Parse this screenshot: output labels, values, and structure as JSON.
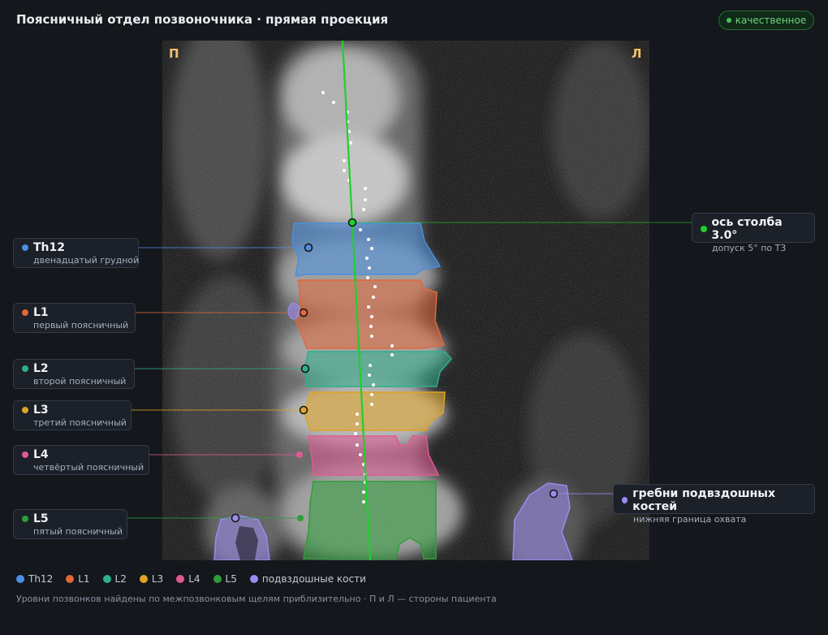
{
  "header": {
    "title": "Поясничный отдел позвоночника · прямая проекция",
    "quality_badge": "качественное"
  },
  "image": {
    "side_right_marker": "П",
    "side_left_marker": "Л"
  },
  "colors": {
    "th12": "#4a90e2",
    "l1": "#e2683a",
    "l2": "#2fae8a",
    "l3": "#e0a424",
    "l4": "#e05a92",
    "l5": "#2f9e3a",
    "iliac": "#9a8cf0",
    "axis": "#1fd02c"
  },
  "vertebrae": [
    {
      "id": "th12",
      "name": "Th12",
      "description": "двенадцатый грудной"
    },
    {
      "id": "l1",
      "name": "L1",
      "description": "первый поясничный"
    },
    {
      "id": "l2",
      "name": "L2",
      "description": "второй поясничный"
    },
    {
      "id": "l3",
      "name": "L3",
      "description": "третий поясничный"
    },
    {
      "id": "l4",
      "name": "L4",
      "description": "четвёртый поясничный"
    },
    {
      "id": "l5",
      "name": "L5",
      "description": "пятый поясничный"
    }
  ],
  "axis_annotation": {
    "title": "ось столба 3.0°",
    "subtitle": "допуск 5° по Т3"
  },
  "iliac_annotation": {
    "title": "гребни подвздошных костей",
    "subtitle": "нижняя граница охвата"
  },
  "legend": [
    {
      "label": "Th12",
      "color": "#4a90e2"
    },
    {
      "label": "L1",
      "color": "#e2683a"
    },
    {
      "label": "L2",
      "color": "#2fae8a"
    },
    {
      "label": "L3",
      "color": "#e0a424"
    },
    {
      "label": "L4",
      "color": "#e05a92"
    },
    {
      "label": "L5",
      "color": "#2f9e3a"
    },
    {
      "label": "подвздошные кости",
      "color": "#9a8cf0"
    }
  ],
  "footnote": "Уровни позвонков найдены по межпозвонковым щелям приблизительно · П и Л — стороны пациента"
}
